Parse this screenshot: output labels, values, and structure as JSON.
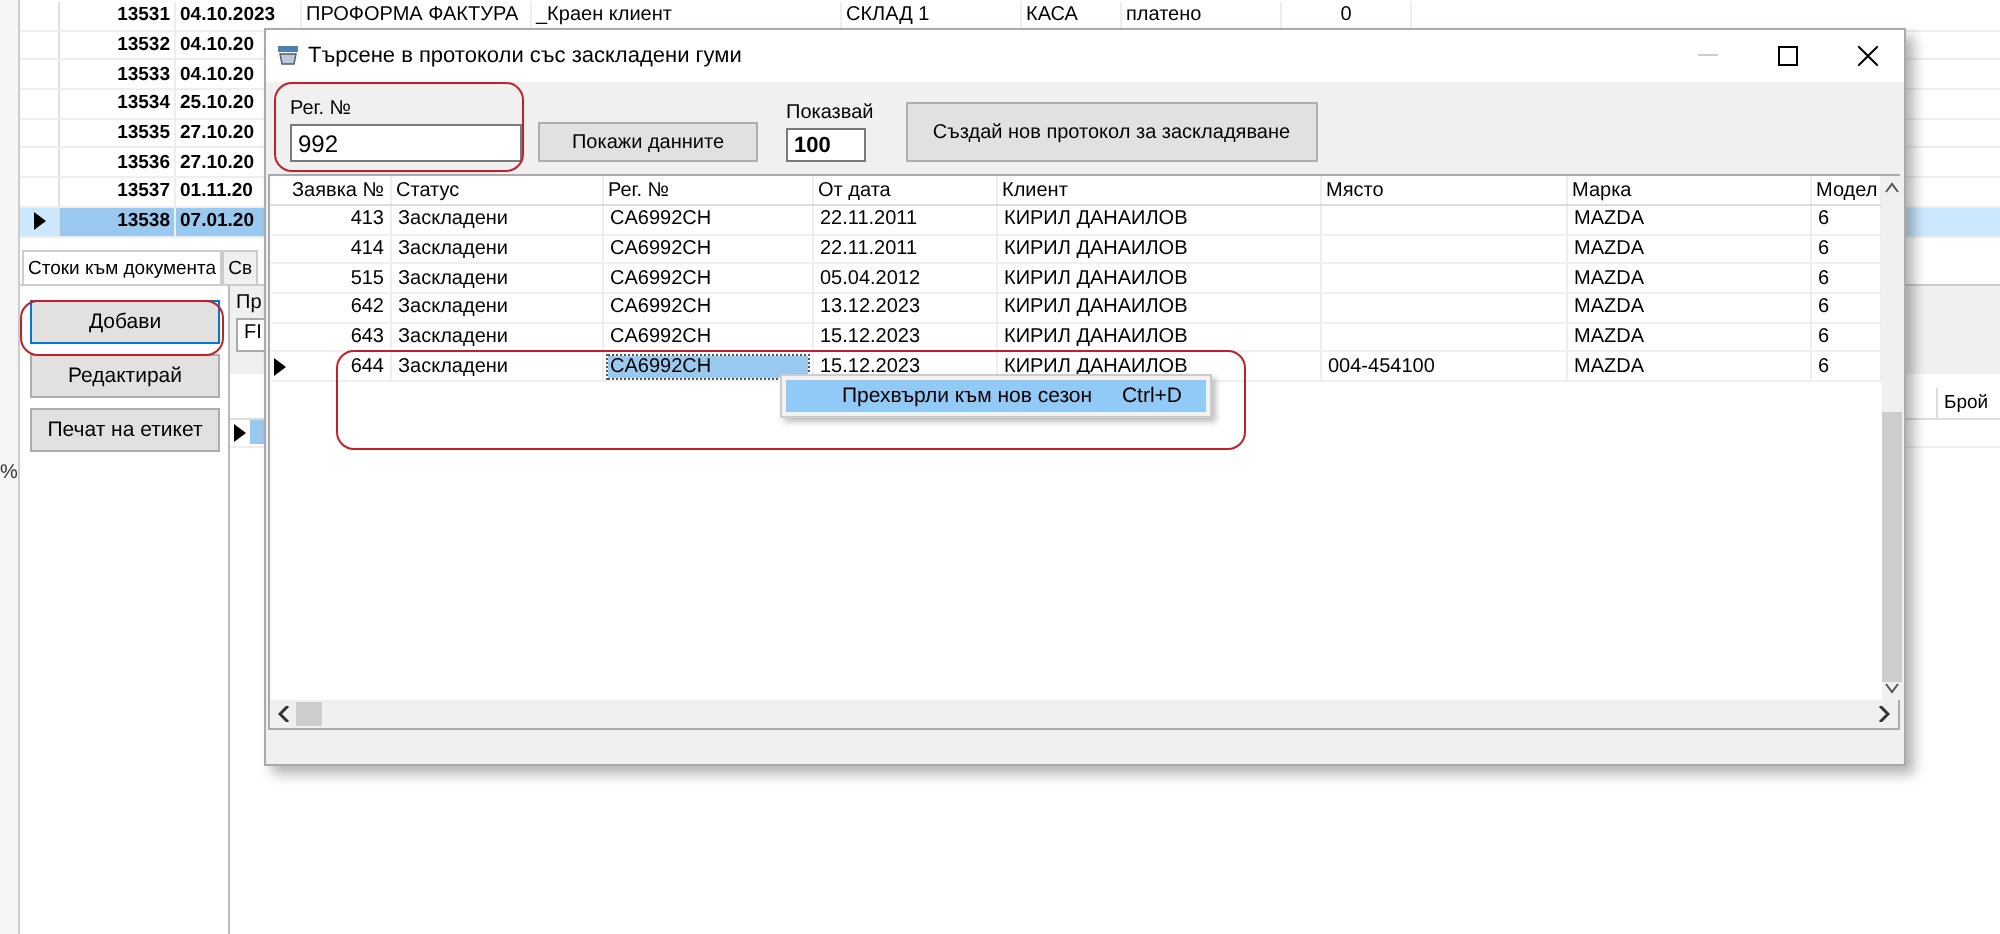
{
  "side_mark": "%",
  "background_table": {
    "rows": [
      {
        "cells": [
          "13531",
          "04.10.2023",
          "ПРОФОРМА ФАКТУРА",
          "_Краен клиент",
          "СКЛАД 1",
          "КАСА",
          "платено",
          "0"
        ],
        "selected": false,
        "current": false
      },
      {
        "cells": [
          "13532",
          "04.10.20"
        ],
        "selected": false,
        "current": false
      },
      {
        "cells": [
          "13533",
          "04.10.20"
        ],
        "selected": false,
        "current": false
      },
      {
        "cells": [
          "13534",
          "25.10.20"
        ],
        "selected": false,
        "current": false
      },
      {
        "cells": [
          "13535",
          "27.10.20"
        ],
        "selected": false,
        "current": false
      },
      {
        "cells": [
          "13536",
          "27.10.20"
        ],
        "selected": false,
        "current": false
      },
      {
        "cells": [
          "13537",
          "01.11.20"
        ],
        "selected": false,
        "current": false
      },
      {
        "cells": [
          "13538",
          "07.01.20"
        ],
        "selected": true,
        "current": true
      }
    ]
  },
  "background_tabs": [
    {
      "label": "Стоки към документа",
      "selected": true
    },
    {
      "label": "Св",
      "selected": false
    }
  ],
  "background_buttons": [
    {
      "label": "Добави",
      "highlighted": true
    },
    {
      "label": "Редактирай",
      "highlighted": false
    },
    {
      "label": "Печат на етикет",
      "highlighted": false
    }
  ],
  "background_panel": {
    "label": "Пр",
    "field_value": "FI",
    "column_header": "Брой"
  },
  "dialog": {
    "title": "Търсене в протоколи със заскладени гуми",
    "reg_label": "Рег. №",
    "reg_value": "992",
    "show_button": "Покажи данните",
    "count_label": "Показвай",
    "count_value": "100",
    "create_button": "Създай нов протокол за заскладяване",
    "columns": [
      {
        "label": "Заявка №",
        "focused": false
      },
      {
        "label": "Статус",
        "focused": false
      },
      {
        "label": "Рег. №",
        "focused": true
      },
      {
        "label": "От дата",
        "focused": false
      },
      {
        "label": "Клиент",
        "focused": false
      },
      {
        "label": "Място",
        "focused": false
      },
      {
        "label": "Марка",
        "focused": false
      },
      {
        "label": "Модел",
        "focused": false
      }
    ],
    "rows": [
      {
        "cells": [
          "413",
          "Заскладени",
          "CA6992CH",
          "22.11.2011",
          "КИРИЛ ДАНАИЛОВ",
          "",
          "MAZDA",
          "6"
        ],
        "current": false
      },
      {
        "cells": [
          "414",
          "Заскладени",
          "CA6992CH",
          "22.11.2011",
          "КИРИЛ ДАНАИЛОВ",
          "",
          "MAZDA",
          "6"
        ],
        "current": false
      },
      {
        "cells": [
          "515",
          "Заскладени",
          "CA6992CH",
          "05.04.2012",
          "КИРИЛ ДАНАИЛОВ",
          "",
          "MAZDA",
          "6"
        ],
        "current": false
      },
      {
        "cells": [
          "642",
          "Заскладени",
          "CA6992CH",
          "13.12.2023",
          "КИРИЛ ДАНАИЛОВ",
          "",
          "MAZDA",
          "6"
        ],
        "current": false
      },
      {
        "cells": [
          "643",
          "Заскладени",
          "CA6992CH",
          "15.12.2023",
          "КИРИЛ ДАНАИЛОВ",
          "",
          "MAZDA",
          "6"
        ],
        "current": false
      },
      {
        "cells": [
          "644",
          "Заскладени",
          "CA6992CH",
          "15.12.2023",
          "КИРИЛ ДАНАИЛОВ",
          "004-454100",
          "MAZDA",
          "6"
        ],
        "current": true
      }
    ]
  },
  "context_menu": {
    "items": [
      {
        "label": "Прехвърли към нов сезон",
        "shortcut": "Ctrl+D",
        "highlighted": true
      }
    ]
  }
}
